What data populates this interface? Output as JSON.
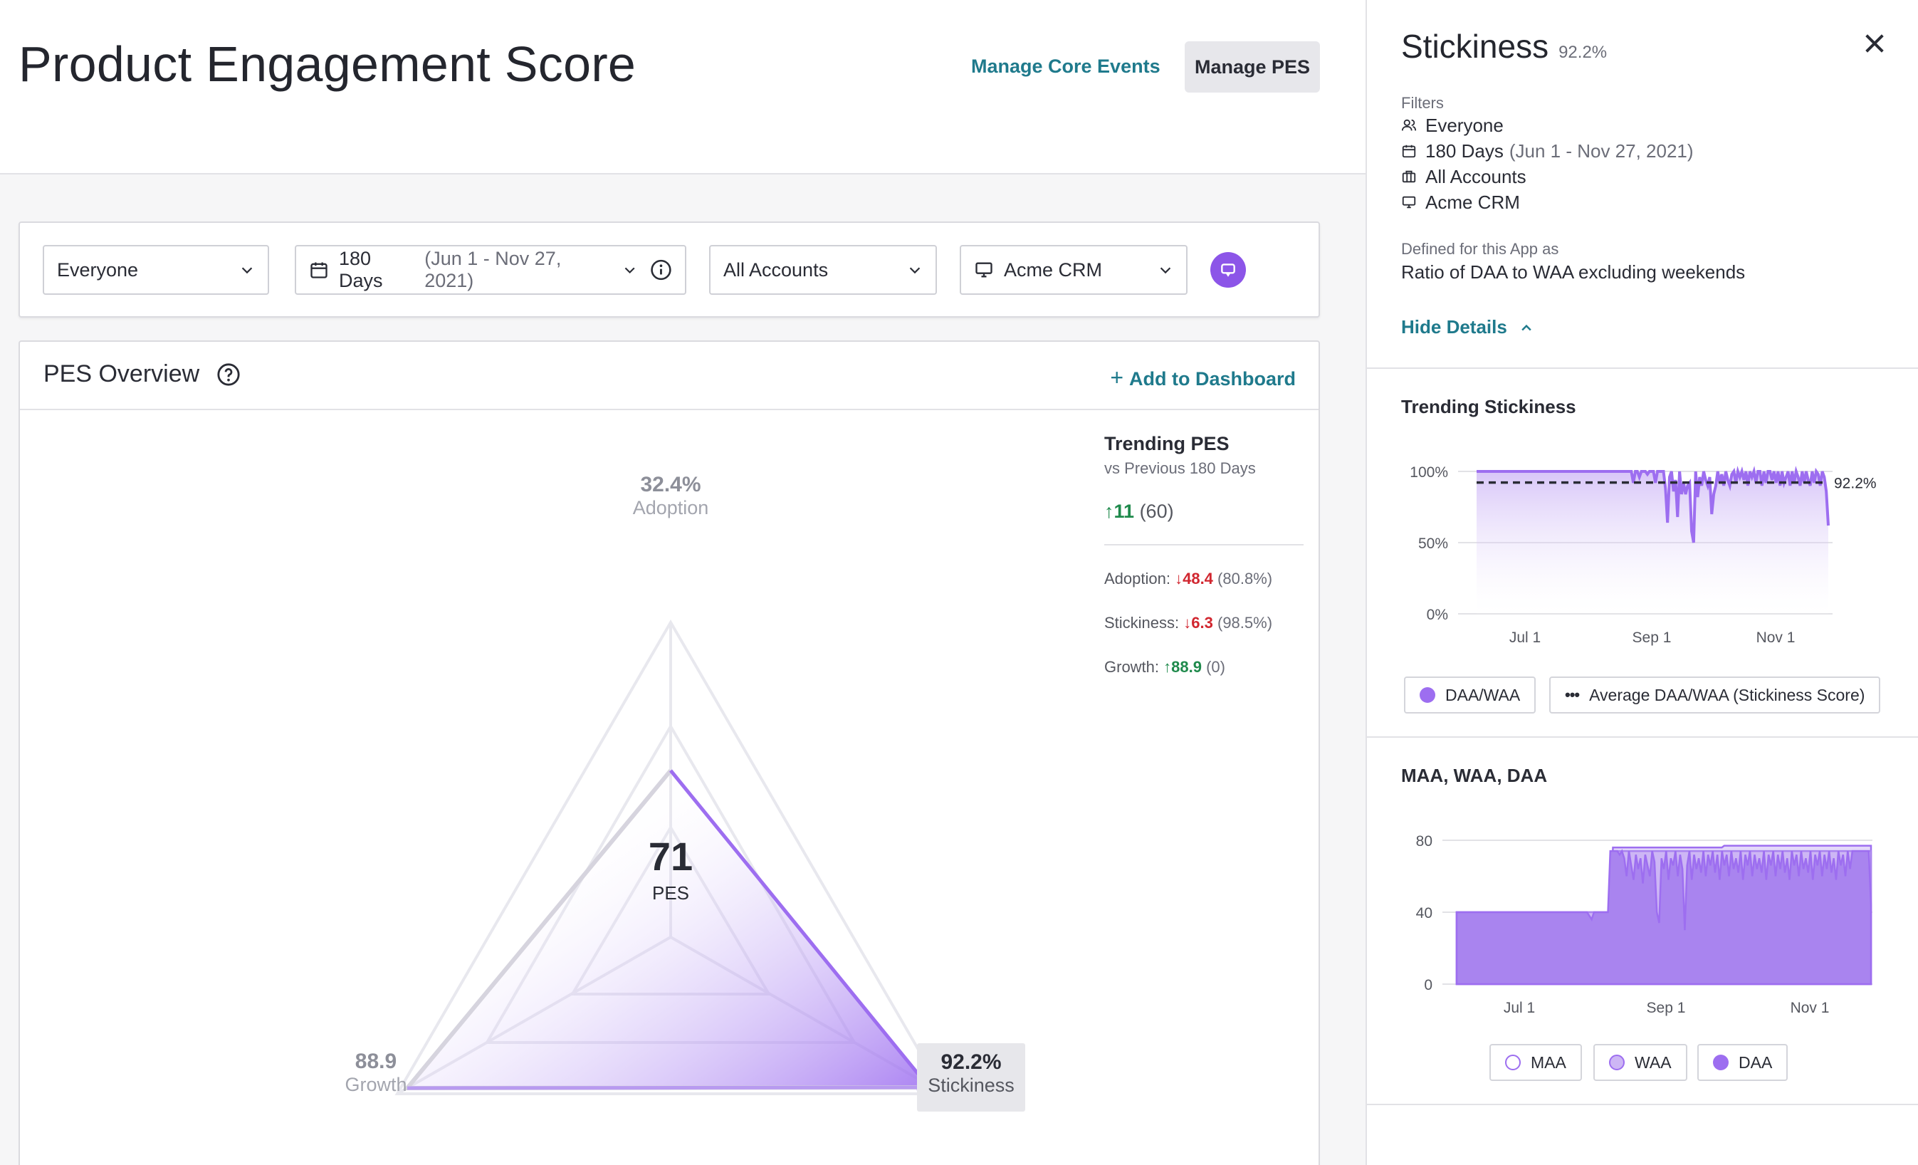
{
  "header": {
    "title": "Product Engagement Score",
    "manage_core_events": "Manage Core Events",
    "manage_pes": "Manage PES"
  },
  "filters": {
    "segment": "Everyone",
    "date_range": "180 Days",
    "date_detail": "(Jun 1 - Nov 27, 2021)",
    "accounts": "All Accounts",
    "app": "Acme CRM"
  },
  "overview": {
    "title": "PES Overview",
    "add_dashboard": "Add to Dashboard",
    "score": "71",
    "score_label": "PES",
    "adoption": {
      "value": "32.4%",
      "label": "Adoption"
    },
    "growth": {
      "value": "88.9",
      "label": "Growth"
    },
    "stickiness": {
      "value": "92.2%",
      "label": "Stickiness"
    },
    "trending": {
      "title": "Trending PES",
      "subtitle": "vs Previous 180 Days",
      "main_delta": "11",
      "main_prev": "(60)",
      "rows": [
        {
          "label": "Adoption:",
          "delta": "48.4",
          "dir": "down",
          "prev": "(80.8%)"
        },
        {
          "label": "Stickiness:",
          "delta": "6.3",
          "dir": "down",
          "prev": "(98.5%)"
        },
        {
          "label": "Growth:",
          "delta": "88.9",
          "dir": "up",
          "prev": "(0)"
        }
      ]
    }
  },
  "drawer": {
    "title": "Stickiness",
    "title_pct": "92.2%",
    "filters_caption": "Filters",
    "filters": [
      {
        "icon": "users-icon",
        "text": "Everyone",
        "sub": ""
      },
      {
        "icon": "calendar-icon",
        "text": "180 Days",
        "sub": "(Jun 1 - Nov 27, 2021)"
      },
      {
        "icon": "briefcase-icon",
        "text": "All Accounts",
        "sub": ""
      },
      {
        "icon": "monitor-icon",
        "text": "Acme CRM",
        "sub": ""
      }
    ],
    "defined_caption": "Defined for this App as",
    "defined_text": "Ratio of DAA to WAA excluding weekends",
    "hide_details": "Hide Details",
    "trending_title": "Trending Stickiness",
    "legend1": "DAA/WAA",
    "legend2": "Average DAA/WAA (Stickiness Score)",
    "maa_title": "MAA, WAA, DAA",
    "legend_maa": "MAA",
    "legend_waa": "WAA",
    "legend_daa": "DAA"
  },
  "colors": {
    "accent": "#8c55e8",
    "link": "#1f7a8c",
    "up": "#1f8a4c",
    "down": "#d1262f"
  },
  "chart_data": [
    {
      "type": "line",
      "title": "Trending Stickiness",
      "x_ticks": [
        "Jul 1",
        "Sep 1",
        "Nov 1"
      ],
      "y_ticks": [
        "0%",
        "50%",
        "100%"
      ],
      "ylim": [
        0,
        100
      ],
      "series": [
        {
          "name": "DAA/WAA",
          "values": [
            100,
            100,
            100,
            100,
            100,
            100,
            100,
            100,
            100,
            100,
            100,
            100,
            100,
            100,
            100,
            100,
            100,
            100,
            100,
            100,
            100,
            100,
            100,
            100,
            100,
            100,
            100,
            100,
            100,
            100,
            100,
            100,
            100,
            100,
            100,
            100,
            100,
            100,
            100,
            100,
            100,
            100,
            100,
            100,
            100,
            100,
            100,
            100,
            100,
            100,
            100,
            100,
            100,
            100,
            100,
            100,
            100,
            100,
            100,
            100,
            100,
            100,
            100,
            100,
            100,
            100,
            100,
            100,
            100,
            100,
            100,
            100,
            100,
            100,
            100,
            100,
            100,
            100,
            92,
            100,
            100,
            96,
            100,
            100,
            100,
            98,
            100,
            100,
            100,
            92,
            100,
            100,
            100,
            100,
            88,
            64,
            96,
            100,
            86,
            94,
            68,
            100,
            84,
            92,
            84,
            90,
            92,
            58,
            50,
            100,
            82,
            96,
            90,
            100,
            94,
            90,
            96,
            70,
            84,
            90,
            100,
            92,
            98,
            90,
            100,
            94,
            90,
            98,
            100,
            92,
            100,
            96,
            100,
            94,
            100,
            90,
            100,
            96,
            100,
            92,
            100,
            100,
            90,
            100,
            92,
            100,
            100,
            94,
            100,
            92,
            100,
            90,
            100,
            92,
            96,
            100,
            90,
            100,
            92,
            100,
            96,
            90,
            100,
            92,
            100,
            94,
            90,
            100,
            92,
            100,
            98,
            90,
            100,
            96,
            86,
            62
          ]
        },
        {
          "name": "Average DAA/WAA (Stickiness Score)",
          "values": [
            92.2
          ]
        }
      ],
      "annotation": "92.2%"
    },
    {
      "type": "area",
      "title": "MAA, WAA, DAA",
      "x_ticks": [
        "Jul 1",
        "Sep 1",
        "Nov 1"
      ],
      "y_ticks": [
        "0",
        "40",
        "80"
      ],
      "ylim": [
        0,
        80
      ],
      "series": [
        {
          "name": "MAA",
          "values": [
            40,
            40,
            40,
            40,
            40,
            40,
            40,
            40,
            40,
            40,
            40,
            40,
            40,
            40,
            40,
            40,
            40,
            40,
            40,
            40,
            40,
            40,
            40,
            40,
            40,
            40,
            40,
            40,
            40,
            40,
            40,
            40,
            40,
            40,
            40,
            40,
            40,
            40,
            40,
            40,
            40,
            40,
            40,
            40,
            40,
            40,
            40,
            40,
            40,
            40,
            40,
            40,
            40,
            40,
            40,
            40,
            40,
            40,
            40,
            40,
            40,
            40,
            40,
            40,
            40,
            40,
            76,
            76,
            76,
            76,
            76,
            76,
            76,
            76,
            76,
            76,
            76,
            76,
            76,
            76,
            76,
            76,
            76,
            76,
            76,
            76,
            76,
            76,
            76,
            76,
            76,
            76,
            76,
            76,
            76,
            76,
            76,
            76,
            76,
            76,
            76,
            76,
            76,
            76,
            76,
            76,
            76,
            76,
            76,
            76,
            76,
            76,
            76,
            77,
            77,
            77,
            77,
            77,
            77,
            77,
            77,
            77,
            77,
            77,
            77,
            77,
            77,
            77,
            77,
            77,
            77,
            77,
            77,
            77,
            77,
            77,
            77,
            77,
            77,
            77,
            77,
            77,
            77,
            77,
            77,
            77,
            77,
            77,
            77,
            77,
            77,
            77,
            77,
            77,
            77,
            77,
            77,
            77,
            77,
            77,
            77,
            77,
            77,
            77,
            77,
            77,
            77,
            77,
            77,
            77,
            77,
            77,
            77,
            77,
            77,
            77
          ]
        },
        {
          "name": "WAA",
          "values": [
            40,
            40,
            40,
            40,
            40,
            40,
            40,
            40,
            40,
            40,
            40,
            40,
            40,
            40,
            40,
            40,
            40,
            40,
            40,
            40,
            40,
            40,
            40,
            40,
            40,
            40,
            40,
            40,
            40,
            40,
            40,
            40,
            40,
            40,
            40,
            40,
            40,
            40,
            40,
            40,
            40,
            40,
            40,
            40,
            40,
            40,
            40,
            40,
            40,
            40,
            40,
            40,
            40,
            40,
            40,
            40,
            40,
            40,
            40,
            40,
            40,
            40,
            40,
            40,
            40,
            40,
            74,
            74,
            74,
            74,
            74,
            74,
            74,
            74,
            74,
            74,
            74,
            74,
            74,
            74,
            74,
            74,
            74,
            74,
            74,
            74,
            74,
            74,
            74,
            74,
            74,
            74,
            74,
            74,
            74,
            74,
            74,
            74,
            74,
            74,
            74,
            74,
            74,
            74,
            74,
            74,
            74,
            74,
            74,
            74,
            74,
            74,
            74,
            74,
            74,
            74,
            74,
            74,
            74,
            74,
            74,
            74,
            74,
            74,
            74,
            74,
            74,
            74,
            74,
            74,
            74,
            74,
            74,
            74,
            74,
            74,
            74,
            74,
            74,
            74,
            74,
            74,
            74,
            74,
            74,
            74,
            74,
            74,
            74,
            74,
            74,
            74,
            74,
            74,
            74,
            74,
            74,
            74,
            74,
            74,
            74,
            74,
            74,
            74,
            74,
            74,
            74,
            74,
            74,
            74,
            74,
            74,
            74,
            74,
            74,
            74
          ]
        },
        {
          "name": "DAA",
          "values": [
            40,
            40,
            40,
            40,
            40,
            40,
            40,
            40,
            40,
            40,
            40,
            40,
            40,
            40,
            40,
            40,
            40,
            40,
            40,
            40,
            40,
            40,
            40,
            40,
            40,
            40,
            40,
            40,
            40,
            40,
            40,
            40,
            40,
            40,
            40,
            40,
            40,
            40,
            40,
            40,
            40,
            40,
            40,
            40,
            40,
            40,
            40,
            40,
            40,
            40,
            40,
            40,
            40,
            40,
            40,
            40,
            40,
            38,
            36,
            40,
            40,
            40,
            40,
            40,
            40,
            40,
            74,
            74,
            74,
            74,
            72,
            74,
            70,
            60,
            74,
            66,
            58,
            72,
            64,
            70,
            56,
            72,
            66,
            60,
            74,
            68,
            40,
            34,
            70,
            64,
            74,
            58,
            70,
            66,
            74,
            60,
            72,
            64,
            30,
            66,
            74,
            58,
            72,
            64,
            70,
            62,
            74,
            60,
            72,
            66,
            74,
            62,
            72,
            58,
            74,
            66,
            72,
            60,
            74,
            64,
            70,
            62,
            74,
            58,
            72,
            66,
            74,
            60,
            72,
            64,
            70,
            62,
            74,
            58,
            72,
            66,
            74,
            60,
            72,
            64,
            74,
            62,
            70,
            58,
            74,
            66,
            72,
            60,
            74,
            64,
            70,
            62,
            74,
            58,
            72,
            66,
            74,
            60,
            72,
            64,
            74,
            62,
            70,
            58,
            74,
            66,
            72,
            60,
            74,
            64,
            74,
            74,
            74,
            74,
            74,
            74,
            74,
            74,
            44
          ]
        }
      ]
    }
  ]
}
